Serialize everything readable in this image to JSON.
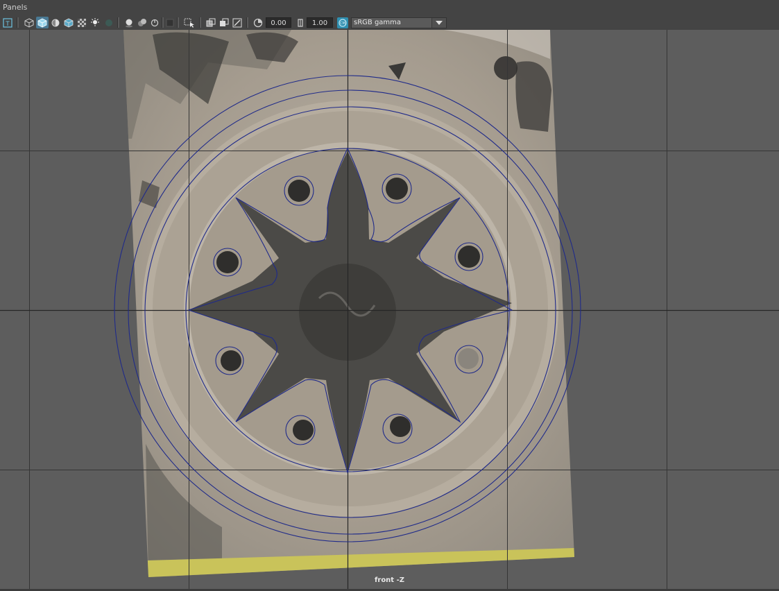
{
  "menubar": {
    "panels_label": "Panels"
  },
  "toolbar": {
    "exposure_value": "0.00",
    "gamma_value": "1.00",
    "color_space": "sRGB gamma",
    "icons": [
      "text-toggle-icon",
      "wireframe-cube-icon",
      "smooth-shade-cube-icon",
      "shade-half-icon",
      "textured-cube-icon",
      "checker-icon",
      "light-bulb-icon",
      "shadow-icon",
      "sphere-ao-icon",
      "spheres-icon",
      "motion-blur-icon",
      "isolate-icon",
      "select-arrow-icon",
      "xray-icon",
      "xray-joints-icon",
      "xray-active-icon",
      "exposure-icon",
      "gamma-icon",
      "color-management-icon",
      "chevron-down-icon"
    ],
    "active_color": "#6cc3e0"
  },
  "viewport": {
    "camera_label": "front -Z",
    "background": "#5d5d5d",
    "curve_color": "#1f2a8a",
    "image_subject": "stone rosette carving with eight-pointed star and circular holes"
  }
}
